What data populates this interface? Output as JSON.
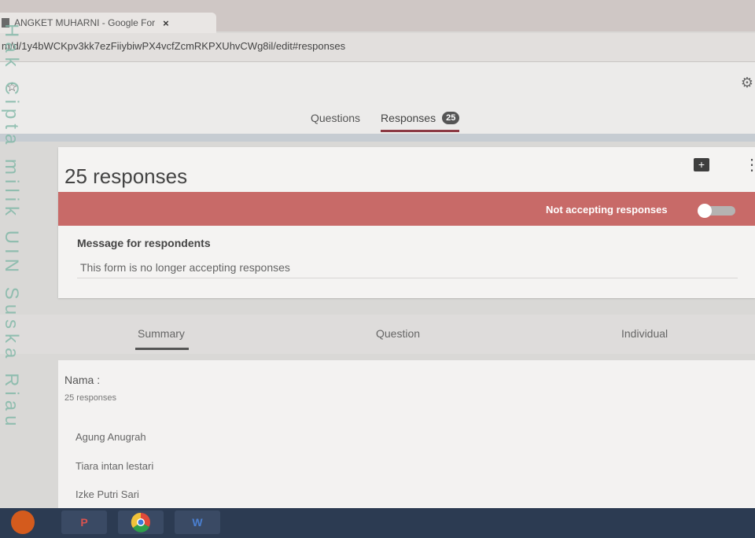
{
  "browser": {
    "tab_title": "ANGKET MUHARNI - Google For",
    "tab_close": "×",
    "url": "m/d/1y4bWCKpv3kk7ezFiiybiwPX4vcfZcmRKPXUhvCWg8il/edit#responses"
  },
  "header": {
    "tabs": [
      {
        "label": "Questions"
      },
      {
        "label": "Responses"
      }
    ],
    "responses_count": "25",
    "star_icon": "☆",
    "palette_icon": "⚙"
  },
  "card": {
    "title": "25 responses",
    "sheets_icon": "+",
    "more_icon": "⋮",
    "accepting_label": "Not accepting responses",
    "accepting_toggle": false,
    "message_title": "Message for respondents",
    "message_text": "This form is no longer accepting responses"
  },
  "subtabs": [
    {
      "label": "Summary"
    },
    {
      "label": "Question"
    },
    {
      "label": "Individual"
    }
  ],
  "question": {
    "label": "Nama :",
    "count": "25 responses",
    "responses": [
      "Agung Anugrah",
      "Tiara intan lestari",
      "Izke Putri Sari"
    ]
  },
  "taskbar": {
    "apps": [
      "P",
      "",
      "W"
    ]
  },
  "watermark": "Hak Cipta milik UIN Suska Riau"
}
